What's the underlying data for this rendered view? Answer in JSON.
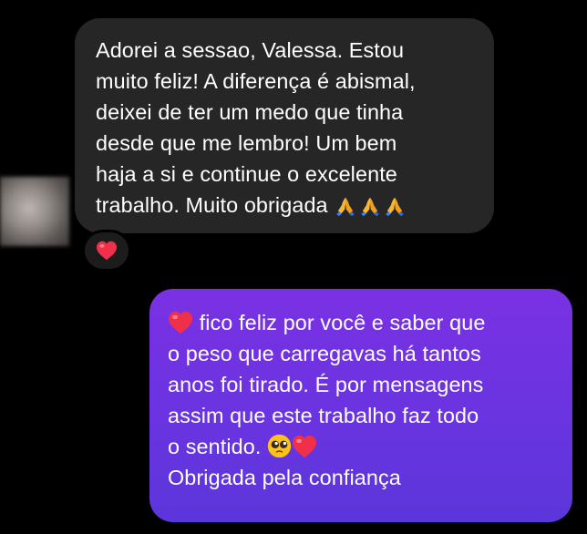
{
  "received_message": {
    "lines": [
      "Adorei a sessao, Valessa. Estou",
      "muito feliz! A diferença é abismal,",
      "deixei de ter um medo que tinha",
      "desde que me lembro! Um bem",
      "haja a si e continue o excelente",
      "trabalho. Muito obrigada"
    ],
    "trailing_emoji": [
      "folded-hands-emoji",
      "folded-hands-emoji",
      "folded-hands-emoji"
    ],
    "reaction_emoji": "red-heart-emoji"
  },
  "sent_message": {
    "lead_emoji": "red-heart-emoji",
    "lines": [
      " fico feliz por você e saber que",
      "o peso que carregavas há tantos",
      "anos foi tirado. É por mensagens",
      "assim que este trabalho faz todo",
      "o sentido. ",
      "Obrigada pela confiança"
    ],
    "line5_emoji": [
      "pleading-face-emoji",
      "red-heart-emoji"
    ]
  },
  "colors": {
    "background": "#000000",
    "received_bubble": "#262626",
    "sent_bubble_top": "#7a31e3",
    "sent_bubble_bottom": "#5b36da",
    "text": "#ffffff"
  }
}
